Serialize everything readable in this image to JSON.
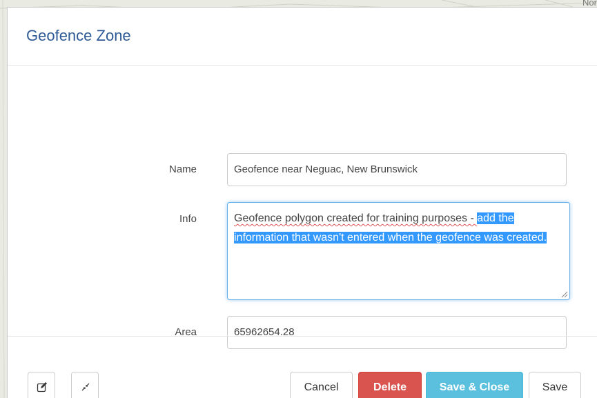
{
  "map": {
    "corner_label": "Nor"
  },
  "modal": {
    "title": "Geofence Zone",
    "fields": {
      "name_label": "Name",
      "name_value": "Geofence near Neguac, New Brunswick",
      "info_label": "Info",
      "info_value_unselected": "Geofence polygon created for training purposes - ",
      "info_value_selected": "add the information that wasn't entered when the geofence was created.",
      "area_label": "Area",
      "area_value": "65962654.28"
    },
    "footer": {
      "edit_icon": "edit-icon",
      "collapse_icon": "collapse-arrows-icon",
      "cancel_label": "Cancel",
      "delete_label": "Delete",
      "save_close_label": "Save & Close",
      "save_label": "Save"
    }
  },
  "colors": {
    "title": "#2e5b96",
    "delete_bg": "#d9534f",
    "save_close_bg": "#5bc0de",
    "focus_border": "#66afe9",
    "selection": "#3399ff"
  }
}
